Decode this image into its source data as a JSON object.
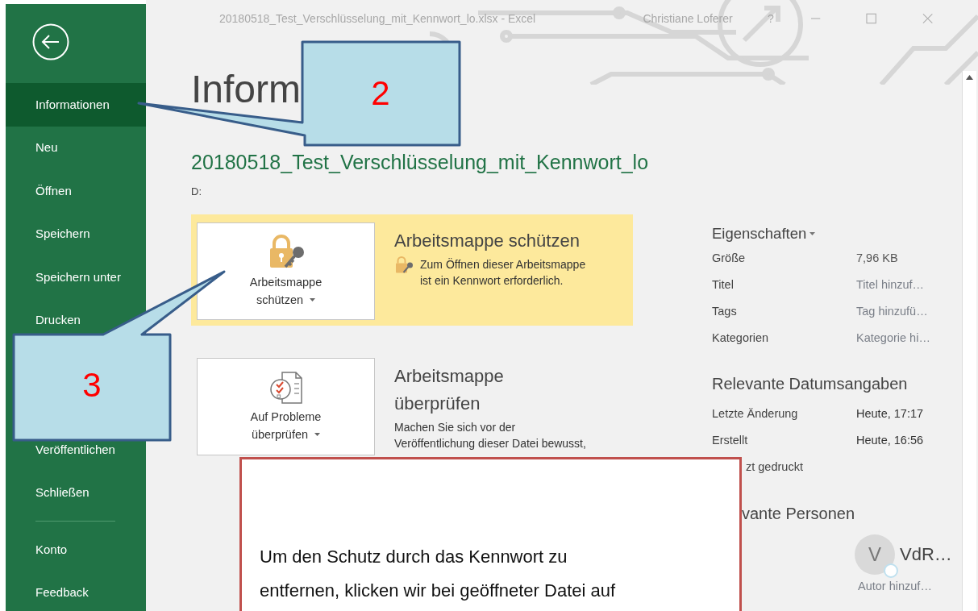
{
  "window": {
    "title": "20180518_Test_Verschlüsselung_mit_Kennwort_lo.xlsx  -  Excel",
    "user": "Christiane Loferer",
    "help": "?"
  },
  "sidebar": {
    "items": [
      {
        "label": "Informationen",
        "selected": true
      },
      {
        "label": "Neu",
        "selected": false
      },
      {
        "label": "Öffnen",
        "selected": false
      },
      {
        "label": "Speichern",
        "selected": false
      },
      {
        "label": "Speichern unter",
        "selected": false
      },
      {
        "label": "Drucken",
        "selected": false
      }
    ],
    "items_below_callout": [
      {
        "label": "Veröffentlichen",
        "selected": false
      },
      {
        "label": "Schließen",
        "selected": false
      }
    ],
    "account_items": [
      {
        "label": "Konto",
        "selected": false
      },
      {
        "label": "Feedback",
        "selected": false
      }
    ]
  },
  "page": {
    "heading": "Inform",
    "file_name": "20180518_Test_Verschlüsselung_mit_Kennwort_lo",
    "location": "D:"
  },
  "sections": [
    {
      "kind": "protect",
      "highlighted": true,
      "button": [
        "Arbeitsmappe",
        "schützen"
      ],
      "title": [
        "Arbeitsmappe schützen"
      ],
      "description": [
        "Zum Öffnen dieser Arbeitsmappe",
        "ist ein Kennwort erforderlich."
      ]
    },
    {
      "kind": "inspect",
      "highlighted": false,
      "button": [
        "Auf Probleme",
        "überprüfen"
      ],
      "title": [
        "Arbeitsmappe",
        "überprüfen"
      ],
      "description": [
        "Machen Sie sich vor der",
        "Veröffentlichung dieser Datei bewusst,"
      ]
    }
  ],
  "properties": {
    "heading": "Eigenschaften",
    "rows": [
      {
        "label": "Größe",
        "value": "7,96 KB"
      },
      {
        "label": "Titel",
        "placeholder": "Titel hinzuf…"
      },
      {
        "label": "Tags",
        "placeholder": "Tag hinzufü…"
      },
      {
        "label": "Kategorien",
        "placeholder": "Kategorie hi…"
      }
    ]
  },
  "dates": {
    "heading": "Relevante Datumsangaben",
    "rows": [
      {
        "label": "Letzte Änderung",
        "value": "Heute, 17:17"
      },
      {
        "label": "Erstellt",
        "value": "Heute, 16:56"
      },
      {
        "label": "zt gedruckt"
      }
    ]
  },
  "people": {
    "heading": "vante Personen",
    "author": {
      "initial": "V",
      "name": "VdR…"
    },
    "add_author": {
      "placeholder": "Autor hinzuf…"
    }
  },
  "callouts": [
    {
      "number": "2"
    },
    {
      "number": "3"
    }
  ],
  "note": {
    "lines": [
      "Um den Schutz durch das Kennwort zu",
      "entfernen, klicken wir bei geöffneter Datei auf"
    ]
  }
}
